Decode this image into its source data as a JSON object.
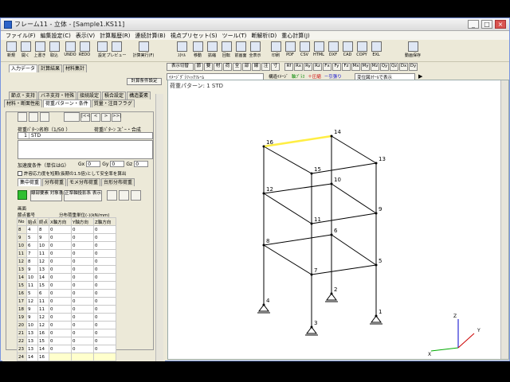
{
  "window": {
    "title": "フレーム11 - 立体 - [Sample1.KS11]",
    "minimize": "_",
    "maximize": "□",
    "close": "×"
  },
  "menu": [
    "ファイル(F)",
    "編集設定(C)",
    "表示(V)",
    "計算履歴(R)",
    "連続計算(B)",
    "視点プリセット(S)",
    "ツール(T)",
    "断解析(D)",
    "重心計算(J)"
  ],
  "toolbar": [
    {
      "label": "新規",
      "icon": "new-file-icon"
    },
    {
      "label": "開く",
      "icon": "open-icon"
    },
    {
      "label": "上書き",
      "icon": "save-icon"
    },
    {
      "label": "取込",
      "icon": "import-icon"
    },
    {
      "label": "UNDO",
      "icon": "undo-icon"
    },
    {
      "label": "REDO",
      "icon": "redo-icon"
    },
    {
      "label": "設定",
      "icon": "settings-icon"
    },
    {
      "label": "プレビュー",
      "icon": "preview-icon"
    },
    {
      "label": "計算実行(F)",
      "icon": "calc-icon"
    },
    {
      "label": "ｽﾀｲﾙ",
      "icon": "style-icon"
    },
    {
      "label": "移動",
      "icon": "move-icon"
    },
    {
      "label": "拡縮",
      "icon": "zoom-icon"
    },
    {
      "label": "回転",
      "icon": "rotate-icon"
    },
    {
      "label": "前画面",
      "icon": "prev-icon"
    },
    {
      "label": "全表示",
      "icon": "fit-icon"
    },
    {
      "label": "印刷",
      "icon": "print-icon"
    },
    {
      "label": "PDF",
      "icon": "pdf-icon"
    },
    {
      "label": "CSV",
      "icon": "csv-icon"
    },
    {
      "label": "HTML",
      "icon": "html-icon"
    },
    {
      "label": "DXF",
      "icon": "dxf-icon"
    },
    {
      "label": "CAD",
      "icon": "cad-icon"
    },
    {
      "label": "COPY",
      "icon": "copy-icon"
    },
    {
      "label": "EXL",
      "icon": "excel-icon"
    },
    {
      "label": "動画保存",
      "icon": "movie-icon"
    }
  ],
  "left": {
    "main_tabs": [
      "入力データ",
      "計算結果",
      "材料集計"
    ],
    "calc_cond": "計算条件設定",
    "sub_tabs1": [
      "節点・支持",
      "バネ支持・特殊",
      "接続設定",
      "積合設定",
      "構造要素"
    ],
    "sub_tabs2": [
      "材料・断面性能",
      "荷重パターン・条件",
      "質量・注目フラグ"
    ],
    "nav": [
      "|<<",
      "<",
      ">",
      ">>|"
    ],
    "pattern_header": "荷重ﾊﾟﾀｰﾝ名称（1/50 ）",
    "pattern_copy": "荷重ﾊﾟﾀｰﾝ ｺﾋﾟｰ・合成",
    "pattern_no": "1",
    "pattern_name": "STD",
    "accel_label": "加速度条件（単位はG）",
    "gx_label": "Gx",
    "gx": "0",
    "gy_label": "Gy",
    "gy": "0",
    "gz_label": "Gz",
    "gz": "0",
    "allow_check": "許容応力度を短期(長期の1.5倍)として安全率を算出",
    "load_tabs": [
      "集中荷重",
      "分布荷重",
      "モメ分布荷重",
      "台形分布荷重"
    ],
    "btn1": "線部要素 対象表示",
    "btn2": "正準軸投影系 表示",
    "screen_label": "画面",
    "elem_label": "節点番号",
    "unit_label": "分布荷重単位(-)(kN/mm)",
    "columns": [
      "No",
      "始点",
      "終点",
      "X軸方向",
      "Y軸方向",
      "Z軸方向"
    ],
    "rows": [
      [
        "8",
        "4",
        "8",
        "0",
        "0",
        "0"
      ],
      [
        "9",
        "5",
        "9",
        "0",
        "0",
        "0"
      ],
      [
        "10",
        "6",
        "10",
        "0",
        "0",
        "0"
      ],
      [
        "11",
        "7",
        "11",
        "0",
        "0",
        "0"
      ],
      [
        "12",
        "8",
        "12",
        "0",
        "0",
        "0"
      ],
      [
        "13",
        "9",
        "13",
        "0",
        "0",
        "0"
      ],
      [
        "14",
        "10",
        "14",
        "0",
        "0",
        "0"
      ],
      [
        "15",
        "11",
        "15",
        "0",
        "0",
        "0"
      ],
      [
        "16",
        "5",
        "6",
        "0",
        "0",
        "0"
      ],
      [
        "17",
        "12",
        "11",
        "0",
        "0",
        "0"
      ],
      [
        "18",
        "9",
        "11",
        "0",
        "0",
        "0"
      ],
      [
        "19",
        "9",
        "12",
        "0",
        "0",
        "0"
      ],
      [
        "20",
        "10",
        "12",
        "0",
        "0",
        "0"
      ],
      [
        "21",
        "13",
        "16",
        "0",
        "0",
        "0"
      ],
      [
        "22",
        "13",
        "15",
        "0",
        "0",
        "0"
      ],
      [
        "23",
        "13",
        "14",
        "0",
        "0",
        "0"
      ],
      [
        "24",
        "14",
        "16",
        "",
        "",
        ""
      ]
    ]
  },
  "view": {
    "graph_label": "ｸﾞﾗﾌｨｯｸﾌﾚｰﾑ",
    "display_switch": "表示切替",
    "view_buttons": [
      "節",
      "要",
      "材",
      "荷",
      "全",
      "部",
      "線",
      "注",
      "寸"
    ],
    "force_buttons": [
      "Rf",
      "Rx",
      "Ry",
      "Rz",
      "Fx",
      "Fy",
      "Fz",
      "Mx",
      "My",
      "Mz"
    ],
    "check_buttons": [
      "Qy",
      "Qz",
      "Dx",
      "Dy"
    ],
    "image_label": "ｲﾒｰｼﾞｸﾞﾗﾌｨｯｸﾌﾚｰﾑ",
    "structure_label": "構造ｲﾒｰｼﾞ",
    "tension": "軸ﾌﾟﾗｽ",
    "compression": "＋圧縮",
    "deform": "－引張り",
    "scale_select": "変位図ｽｹｰﾙで表示",
    "heading": "荷重パターン: 1 STD",
    "axis_x": "X",
    "axis_y": "Y",
    "axis_z": "Z",
    "nodes": [
      "1",
      "2",
      "3",
      "4",
      "5",
      "6",
      "7",
      "8",
      "9",
      "10",
      "11",
      "12",
      "13",
      "14",
      "15",
      "16"
    ]
  },
  "colors": {
    "accent": "#ffff00",
    "frame": "#000000",
    "selected_member": "#ffee44",
    "panel_bg": "#ece9d8"
  }
}
